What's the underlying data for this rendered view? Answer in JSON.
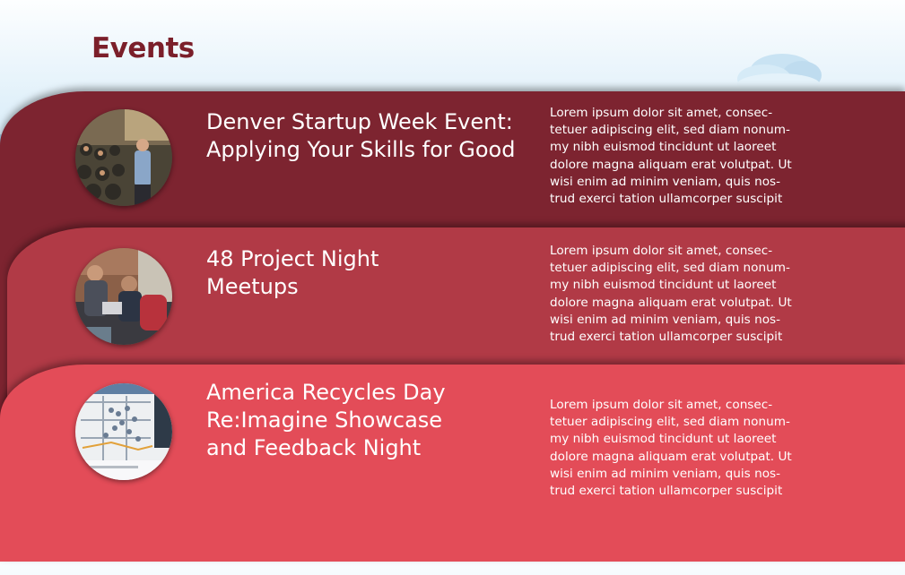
{
  "page": {
    "title": "Events"
  },
  "events": [
    {
      "title": "Denver Startup Week Event:\nApplying Your Skills for Good",
      "description": "Lorem ipsum dolor sit amet, consec-\ntetuer adipiscing elit, sed diam nonum-\nmy nibh euismod tincidunt ut laoreet\ndolore magna aliquam erat volutpat. Ut\nwisi enim ad minim veniam, quis nos-\ntrud exerci tation ullamcorper suscipit",
      "image": "presentation-crowd-photo"
    },
    {
      "title": "48 Project Night\nMeetups",
      "description": "Lorem ipsum dolor sit amet, consec-\ntetuer adipiscing elit, sed diam nonum-\nmy nibh euismod tincidunt ut laoreet\ndolore magna aliquam erat volutpat. Ut\nwisi enim ad minim veniam, quis nos-\ntrud exerci tation ullamcorper suscipit",
      "image": "people-with-laptops-photo"
    },
    {
      "title": "America Recycles Day\nRe:Imagine Showcase\nand Feedback Night",
      "description": "Lorem ipsum dolor sit amet, consec-\ntetuer adipiscing elit, sed diam nonum-\nmy nibh euismod tincidunt ut laoreet\ndolore magna aliquam erat volutpat. Ut\nwisi enim ad minim veniam, quis nos-\ntrud exerci tation ullamcorper suscipit",
      "image": "map-screenshot"
    }
  ],
  "colors": {
    "title": "#7b1f2a",
    "band_dark": "#7d2430",
    "band_mid": "#b13a46",
    "band_light": "#e34c58",
    "sky": "#a6d2ef"
  }
}
